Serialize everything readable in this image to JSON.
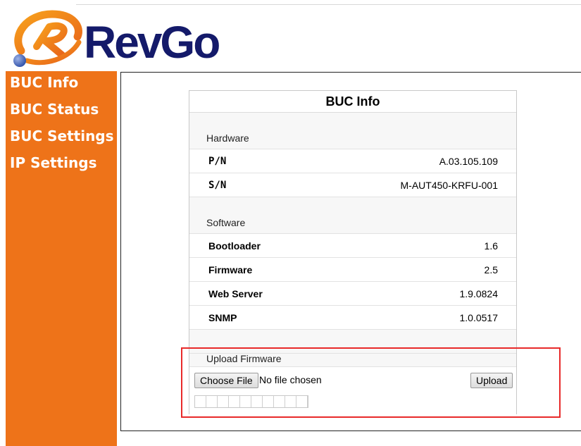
{
  "logo": {
    "text": "RevGo"
  },
  "nav": {
    "items": [
      {
        "label": "BUC Info"
      },
      {
        "label": "BUC Status"
      },
      {
        "label": "BUC Settings"
      },
      {
        "label": "IP Settings"
      }
    ]
  },
  "panel": {
    "title": "BUC Info",
    "hardware": {
      "heading": "Hardware",
      "rows": [
        {
          "label": "P/N",
          "value": "A.03.105.109"
        },
        {
          "label": "S/N",
          "value": "M-AUT450-KRFU-001"
        }
      ]
    },
    "software": {
      "heading": "Software",
      "rows": [
        {
          "label": "Bootloader",
          "value": "1.6"
        },
        {
          "label": "Firmware",
          "value": "2.5"
        },
        {
          "label": "Web Server",
          "value": "1.9.0824"
        },
        {
          "label": "SNMP",
          "value": "1.0.0517"
        }
      ]
    },
    "upload": {
      "heading": "Upload Firmware",
      "choose_label": "Choose File",
      "file_status": "No file chosen",
      "upload_label": "Upload",
      "progress": 0
    }
  },
  "colors": {
    "sidebar": "#ee7319",
    "logo_text": "#141a6a",
    "highlight": "#e82a2a"
  }
}
